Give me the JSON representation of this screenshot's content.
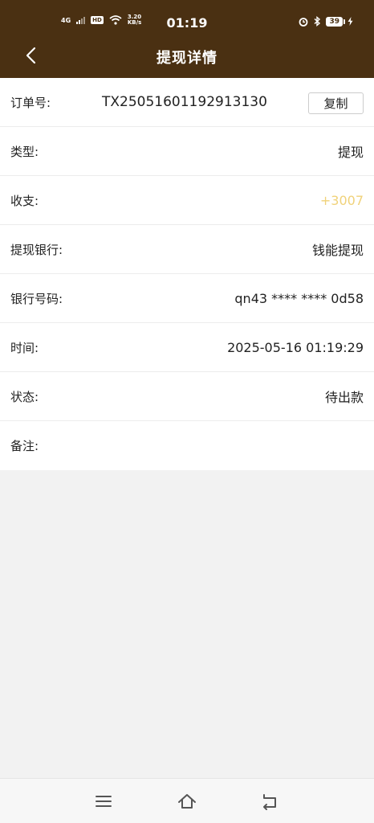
{
  "status_bar": {
    "network": "4G",
    "hd": "HD",
    "speed_top": "3.20",
    "speed_unit": "KB/s",
    "time": "01:19",
    "battery": "39"
  },
  "header": {
    "title": "提现详情"
  },
  "details": {
    "order_label": "订单号:",
    "order_value": "TX25051601192913130",
    "copy_label": "复制",
    "type_label": "类型:",
    "type_value": "提现",
    "amount_label": "收支:",
    "amount_value": "+3007",
    "bank_label": "提现银行:",
    "bank_value": "钱能提现",
    "account_label": "银行号码:",
    "account_value": "qn43 **** **** 0d58",
    "time_label": "时间:",
    "time_value": "2025-05-16 01:19:29",
    "status_label": "状态:",
    "status_value": "待出款",
    "note_label": "备注:"
  },
  "colors": {
    "header_bg": "#4a3012",
    "amount": "#f0d27a"
  },
  "icons": {
    "back": "chevron-left-icon",
    "menu": "menu-icon",
    "home": "home-icon",
    "return": "return-icon"
  }
}
